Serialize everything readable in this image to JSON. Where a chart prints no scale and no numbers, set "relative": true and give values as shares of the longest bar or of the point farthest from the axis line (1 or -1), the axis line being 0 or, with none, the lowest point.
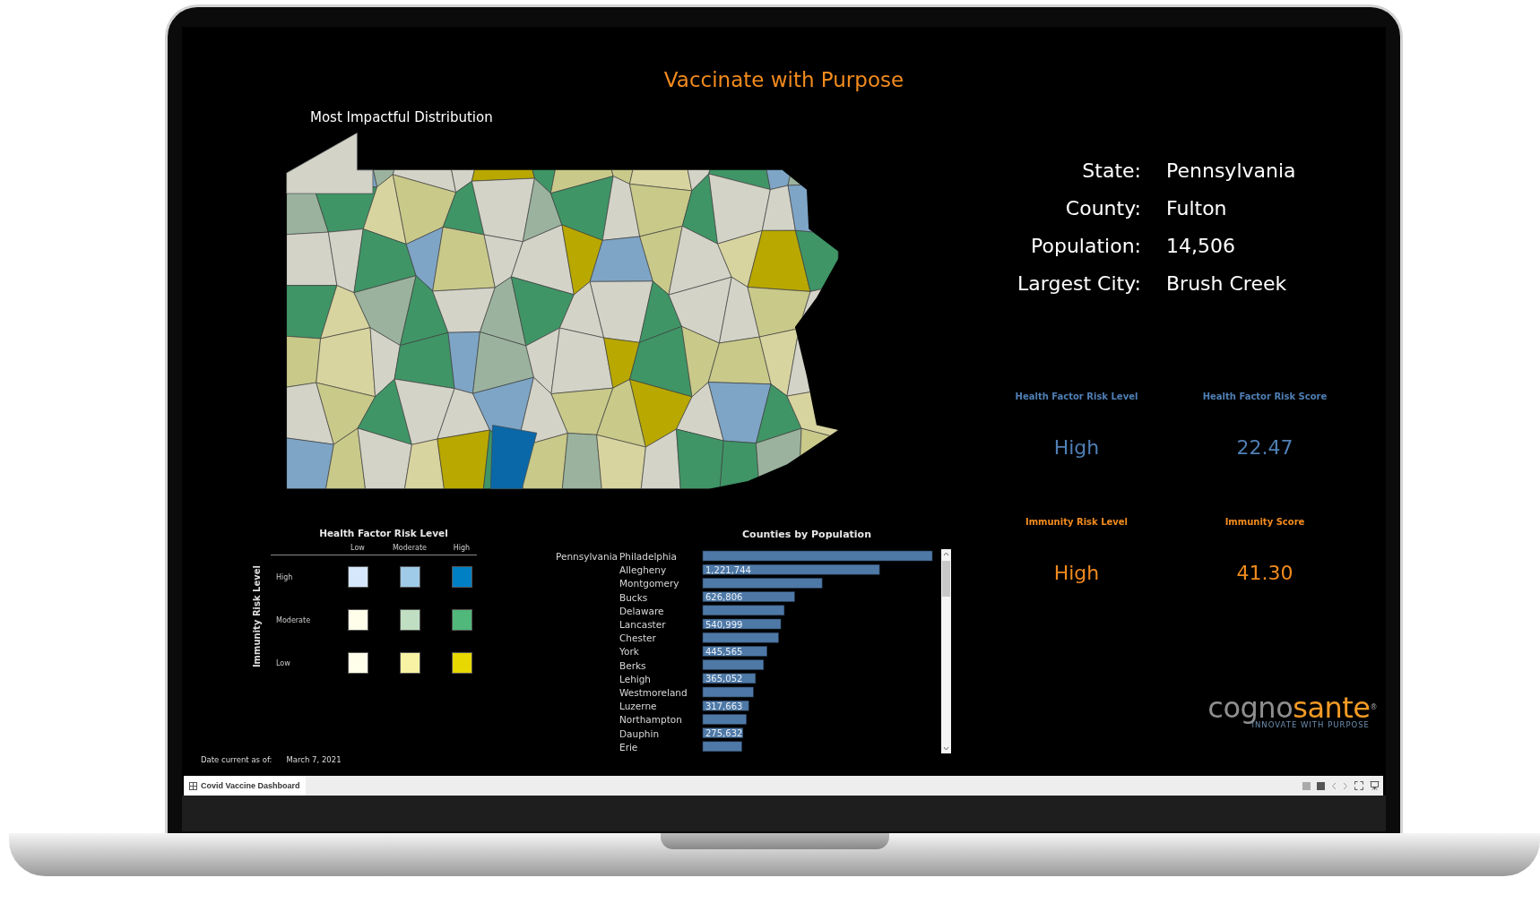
{
  "dashboard": {
    "title": "Vaccinate with Purpose"
  },
  "map": {
    "title": "Most Impactful Distribution"
  },
  "details": [
    {
      "label": "State:",
      "value": "Pennsylvania"
    },
    {
      "label": "County:",
      "value": "Fulton"
    },
    {
      "label": "Population:",
      "value": "14,506"
    },
    {
      "label": "Largest City:",
      "value": "Brush Creek"
    }
  ],
  "risk_panels": [
    {
      "kind": "health",
      "label": "Health Factor Risk Level",
      "value": "High"
    },
    {
      "kind": "health",
      "label": "Health Factor Risk Score",
      "value": "22.47"
    },
    {
      "kind": "immunity",
      "label": "Immunity Risk Level",
      "value": "High"
    },
    {
      "kind": "immunity",
      "label": "Immunity Score",
      "value": "41.30"
    }
  ],
  "legend": {
    "title": "Health Factor Risk Level",
    "columns": [
      "Low",
      "Moderate",
      "High"
    ],
    "axis_label": "Immunity Risk Level",
    "rows": [
      {
        "label": "High",
        "cells": [
          {
            "color": "#d6e6fb"
          },
          {
            "color": "#9fcbe8"
          },
          {
            "color": "#0080c4"
          }
        ]
      },
      {
        "label": "Moderate",
        "cells": [
          {
            "color": "#fefeea"
          },
          {
            "color": "#c0dfc2"
          },
          {
            "color": "#50b87a"
          }
        ]
      },
      {
        "label": "Low",
        "cells": [
          {
            "color": "#fefeea"
          },
          {
            "color": "#f8f3a4"
          },
          {
            "color": "#e6d800"
          }
        ]
      }
    ]
  },
  "bar_chart": {
    "group_label": "Pennsylvania",
    "chart_data": {
      "type": "bar",
      "orientation": "horizontal",
      "title": "Counties by Population",
      "categories": [
        "Philadelphia",
        "Allegheny",
        "Montgomery",
        "Bucks",
        "Delaware",
        "Lancaster",
        "Chester",
        "York",
        "Berks",
        "Lehigh",
        "Westmoreland",
        "Luzerne",
        "Northampton",
        "Dauphin",
        "Erie"
      ],
      "relative": true,
      "series": [
        {
          "color": "#4e79a7",
          "values": [
            1.0,
            0.77,
            0.52,
            0.4,
            0.355,
            0.34,
            0.33,
            0.28,
            0.265,
            0.23,
            0.22,
            0.2,
            0.19,
            0.175,
            0.17
          ]
        }
      ],
      "value_labels": [
        null,
        "1,221,744",
        null,
        "626,806",
        null,
        "540,999",
        null,
        "445,565",
        null,
        "365,052",
        null,
        "317,663",
        null,
        "275,632",
        null
      ]
    }
  },
  "date": {
    "label": "Date current as of:",
    "value": "March 7, 2021"
  },
  "logo": {
    "name_start": "cogno",
    "name_end": "sante",
    "mark": "®",
    "tagline": "INNOVATE WITH PURPOSE"
  },
  "tab_bar": {
    "tabs": [
      {
        "label": "Covid Vaccine Dashboard",
        "selected": true
      }
    ]
  }
}
